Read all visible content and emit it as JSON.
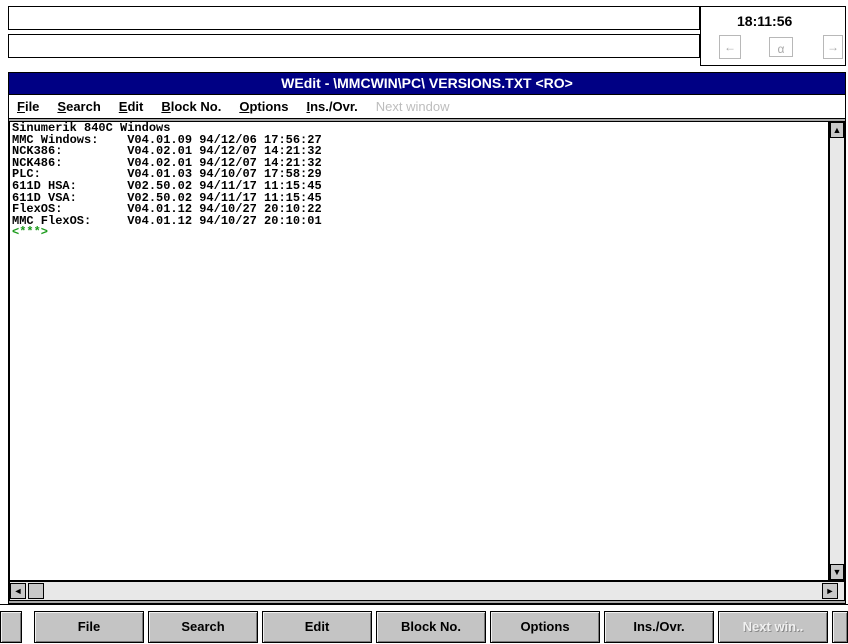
{
  "clock": {
    "time": "18:11:56"
  },
  "status_icons": [
    {
      "name": "arrow-left-icon",
      "glyph": "←"
    },
    {
      "name": "abc-icon",
      "glyph": "α"
    },
    {
      "name": "exit-icon",
      "glyph": "→"
    }
  ],
  "window": {
    "title": "WEdit - \\MMCWIN\\PC\\ VERSIONS.TXT <RO>"
  },
  "menu": {
    "file": {
      "first": "F",
      "rest": "ile"
    },
    "search": {
      "first": "S",
      "rest": "earch"
    },
    "edit": {
      "first": "E",
      "rest": "dit"
    },
    "block": {
      "first": "B",
      "rest": "lock No."
    },
    "options": {
      "first": "O",
      "rest": "ptions"
    },
    "insovr": {
      "first": "I",
      "rest": "ns./Ovr."
    },
    "next_window": "Next window"
  },
  "content": {
    "lines": [
      "Sinumerik 840C Windows",
      "MMC Windows:    V04.01.09 94/12/06 17:56:27",
      "NCK386:         V04.02.01 94/12/07 14:21:32",
      "NCK486:         V04.02.01 94/12/07 14:21:32",
      "PLC:            V04.01.03 94/10/07 17:58:29",
      "611D HSA:       V02.50.02 94/11/17 11:15:45",
      "611D VSA:       V02.50.02 94/11/17 11:15:45",
      "FlexOS:         V04.01.12 94/10/27 20:10:22",
      "MMC FlexOS:     V04.01.12 94/10/27 20:10:01"
    ],
    "eof_marker": "<***>"
  },
  "softkeys": {
    "file": "File",
    "search": "Search",
    "edit": "Edit",
    "block": "Block No.",
    "options": "Options",
    "insovr": "Ins./Ovr.",
    "next": "Next win.."
  },
  "colors": {
    "title_bar": "#000084",
    "eof_marker": "#1a9a1a",
    "softkey": "#c4c4c4"
  }
}
